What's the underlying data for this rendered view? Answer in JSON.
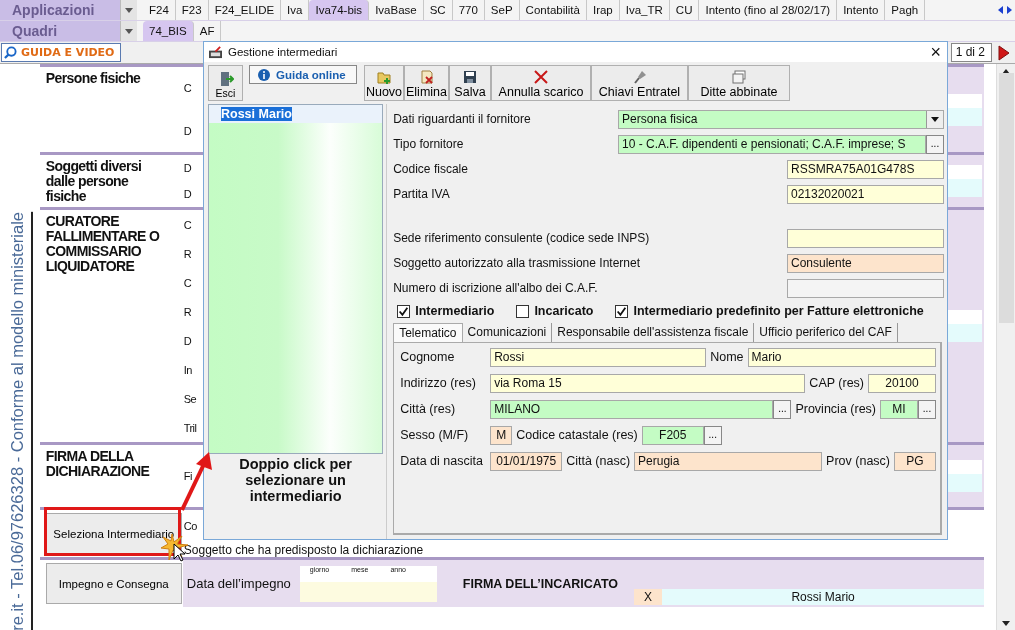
{
  "applicazioni": {
    "label": "Applicazioni",
    "tabs": [
      {
        "label": "F24",
        "selected": false
      },
      {
        "label": "F23",
        "selected": false
      },
      {
        "label": "F24_ELIDE",
        "selected": false
      },
      {
        "label": "Iva",
        "selected": false
      },
      {
        "label": "Iva74-bis",
        "selected": true
      },
      {
        "label": "IvaBase",
        "selected": false
      },
      {
        "label": "SC",
        "selected": false
      },
      {
        "label": "770",
        "selected": false
      },
      {
        "label": "SeP",
        "selected": false
      },
      {
        "label": "Contabilità",
        "selected": false
      },
      {
        "label": "Irap",
        "selected": false
      },
      {
        "label": "Iva_TR",
        "selected": false
      },
      {
        "label": "CU",
        "selected": false
      },
      {
        "label": "Intento (fino al 28/02/17)",
        "selected": false
      },
      {
        "label": "Intento",
        "selected": false
      },
      {
        "label": "Pagh",
        "selected": false
      }
    ]
  },
  "quadri": {
    "label": "Quadri",
    "tabs": [
      {
        "label": "74_BIS",
        "selected": true
      },
      {
        "label": "AF",
        "selected": false
      }
    ]
  },
  "guide_button": "GUIDA E VIDEO",
  "page_indicator": "1 di 2",
  "side_text": "re.it - Tel.06/97626328 - Conforme al modello ministeriale",
  "sections": [
    {
      "title": "Persone fisiche",
      "fragments": [
        "C",
        "D"
      ]
    },
    {
      "title": "Soggetti diversi dalle persone fisiche",
      "fragments": [
        "D",
        "D"
      ]
    },
    {
      "title": "CURATORE FALLIMENTARE O COMMISSARIO LIQUIDATORE",
      "fragments": [
        "C",
        "R",
        "C",
        "R",
        "D",
        "In",
        "Se",
        "Tril"
      ]
    },
    {
      "title": "FIRMA DELLA DICHIARAZIONE",
      "fragments": [
        "Fi"
      ]
    }
  ],
  "select_button": "Seleziona Intermediario",
  "select_fragment": "Co",
  "preparer_label": "Soggetto che ha predisposto la dichiarazione",
  "commit_button": "Impegno e Consegna",
  "commit_date": {
    "label": "Data dell’impegno",
    "parts": [
      "giorno",
      "mese",
      "anno"
    ]
  },
  "signature": {
    "label": "FIRMA DELL’INCARICATO",
    "mark": "X",
    "name": "Rossi Mario"
  },
  "dialog": {
    "title": "Gestione intermediari",
    "close": "×",
    "exit": "Esci",
    "help": "Guida online",
    "actions": [
      {
        "label": "Nuovo",
        "kind": "new"
      },
      {
        "label": "Elimina",
        "kind": "delete"
      },
      {
        "label": "Salva",
        "kind": "save"
      },
      {
        "label": "Annulla scarico",
        "kind": "cancel"
      },
      {
        "label": "Chiavi Entratel",
        "kind": "key"
      },
      {
        "label": "Ditte abbinate",
        "kind": "windows"
      }
    ],
    "list": [
      {
        "name": "Rossi  Mario",
        "selected": true
      }
    ],
    "list_hint": "Doppio click per selezionare un intermediario",
    "fields": [
      {
        "label": "Dati riguardanti il fornitore",
        "value": "Persona fisica",
        "kind": "select"
      },
      {
        "label": "Tipo fornitore",
        "value": "10 - C.A.F. dipendenti e pensionati; C.A.F. imprese; S",
        "kind": "lookup",
        "picker": "..."
      },
      {
        "label": "Codice fiscale",
        "value": "RSSMRA75A01G478S",
        "kind": "input"
      },
      {
        "label": "Partita IVA",
        "value": "02132020021",
        "kind": "input"
      },
      {
        "label": "Sede riferimento consulente (codice sede INPS)",
        "kind": "input"
      },
      {
        "label": "Soggetto autorizzato alla trasmissione Internet",
        "value": "Consulente",
        "kind": "derived"
      },
      {
        "label": "Numero di iscrizione all'albo dei C.A.F.",
        "kind": "readonly"
      }
    ],
    "checks": [
      {
        "label": "Intermediario",
        "checked": true
      },
      {
        "label": "Incaricato",
        "checked": false
      },
      {
        "label": "Intermediario predefinito per Fatture elettroniche",
        "checked": true
      }
    ],
    "tabs": [
      {
        "label": "Telematico",
        "selected": true
      },
      {
        "label": "Comunicazioni",
        "selected": false
      },
      {
        "label": "Responsabile dell'assistenza fiscale",
        "selected": false
      },
      {
        "label": "Ufficio periferico del CAF",
        "selected": false
      }
    ],
    "telematico": [
      {
        "label": "Cognome",
        "value": "Rossi",
        "kind": "input"
      },
      {
        "label": "Nome",
        "value": "Mario",
        "kind": "input"
      },
      {
        "label": "Indirizzo (res)",
        "value": "via Roma 15",
        "kind": "input"
      },
      {
        "label": "CAP (res)",
        "value": "20100",
        "kind": "input"
      },
      {
        "label": "Città (res)",
        "value": "MILANO",
        "kind": "lookup",
        "picker": "..."
      },
      {
        "label": "Provincia (res)",
        "value": "MI",
        "kind": "lookup",
        "picker": "..."
      },
      {
        "label": "Sesso (M/F)",
        "value": "M",
        "kind": "derived"
      },
      {
        "label": "Codice catastale (res)",
        "value": "F205",
        "kind": "lookup",
        "picker": "..."
      },
      {
        "label": "Data di nascita",
        "value": "01/01/1975",
        "kind": "derived"
      },
      {
        "label": "Città (nasc)",
        "value": "Perugia",
        "kind": "derived"
      },
      {
        "label": "Prov (nasc)",
        "value": "PG",
        "kind": "derived"
      }
    ]
  }
}
